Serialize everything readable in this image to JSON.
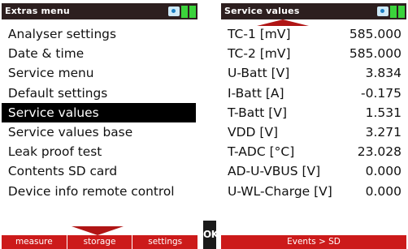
{
  "left_screen": {
    "title": "Extras menu",
    "menu_items": [
      {
        "label": "Analyser settings"
      },
      {
        "label": "Date & time"
      },
      {
        "label": "Service menu"
      },
      {
        "label": "Default settings"
      },
      {
        "label": "Service values",
        "selected": true
      },
      {
        "label": "Service values base"
      },
      {
        "label": "Leak proof test"
      },
      {
        "label": "Contents SD card"
      },
      {
        "label": "Device info remote control"
      }
    ],
    "softkeys": [
      "measure",
      "storage",
      "settings"
    ]
  },
  "ok_button": {
    "label": "OK"
  },
  "right_screen": {
    "title": "Service values",
    "rows": [
      {
        "label": "TC-1 [mV]",
        "value": "585.000"
      },
      {
        "label": "TC-2 [mV]",
        "value": "585.000"
      },
      {
        "label": "U-Batt [V]",
        "value": "3.834"
      },
      {
        "label": "I-Batt [A]",
        "value": "-0.175"
      },
      {
        "label": "T-Batt [V]",
        "value": "1.531"
      },
      {
        "label": "VDD [V]",
        "value": "3.271"
      },
      {
        "label": "T-ADC [°C]",
        "value": "23.028"
      },
      {
        "label": "AD-U-VBUS [V]",
        "value": "0.000"
      },
      {
        "label": "U-WL-Charge [V]",
        "value": "0.000"
      }
    ],
    "softkeys": [
      "Events > SD"
    ]
  },
  "colors": {
    "title_bar": "#2d1f1f",
    "softkey_bar": "#cc1a1a",
    "pointer": "#b01515",
    "selection": "#000000",
    "battery": "#3bd33b"
  },
  "icons": [
    "device-connection-icon",
    "battery-icon"
  ]
}
